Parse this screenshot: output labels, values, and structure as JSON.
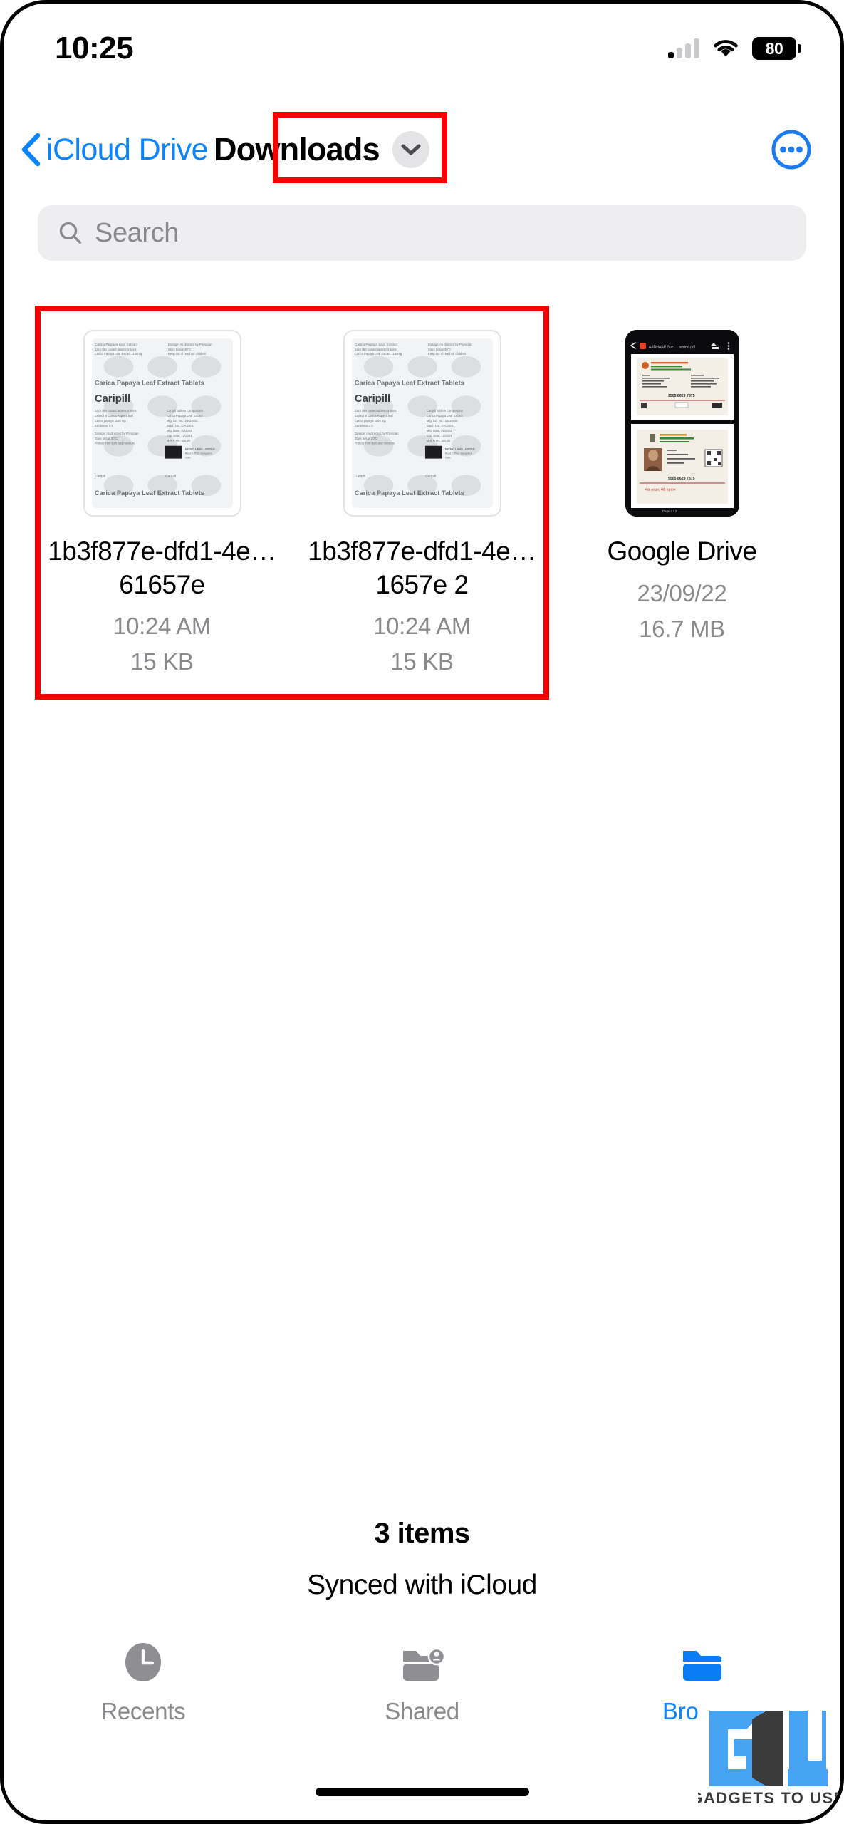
{
  "status_bar": {
    "time": "10:25",
    "cellular_icon": "cellular-signal-icon",
    "wifi_icon": "wifi-icon",
    "battery_level": "80"
  },
  "nav": {
    "back_label": "iCloud Drive",
    "back_icon": "chevron-left-icon",
    "title": "Downloads",
    "dropdown_icon": "chevron-down-icon",
    "more_icon": "ellipsis-circle-icon"
  },
  "search": {
    "placeholder": "Search",
    "value": "",
    "icon": "search-icon"
  },
  "files": [
    {
      "name": "1b3f877e-dfd1-4e…61657e",
      "date": "10:24 AM",
      "size": "15 KB",
      "thumbnail": "medicine-blister-pack-image",
      "thumb_text_1": "Carica Papaya Leaf Extract Tablets",
      "thumb_text_2": "Caripill"
    },
    {
      "name": "1b3f877e-dfd1-4e…1657e 2",
      "date": "10:24 AM",
      "size": "15 KB",
      "thumbnail": "medicine-blister-pack-image",
      "thumb_text_1": "Carica Papaya Leaf Extract Tablets",
      "thumb_text_2": "Caripill"
    },
    {
      "name": "Google Drive",
      "date": "23/09/22",
      "size": "16.7 MB",
      "thumbnail": "pdf-viewer-screenshot",
      "thumb_text_1": "",
      "thumb_text_2": ""
    }
  ],
  "footer": {
    "item_count": "3 items",
    "sync_status": "Synced with iCloud"
  },
  "tabs": [
    {
      "label": "Recents",
      "icon": "clock-icon",
      "active": false
    },
    {
      "label": "Shared",
      "icon": "folder-person-icon",
      "active": false
    },
    {
      "label": "Browse",
      "icon": "folder-icon",
      "active": true
    }
  ],
  "annotations": {
    "title_highlight": "Downloads title highlighted",
    "files_highlight": "Duplicated files highlighted"
  },
  "watermark": {
    "logo": "GU",
    "text": "GADGETS TO USE"
  },
  "colors": {
    "accent": "#0a84ff",
    "annotation": "#f70000",
    "secondary_text": "#8a8a8e",
    "search_bg": "#eeeef0"
  }
}
